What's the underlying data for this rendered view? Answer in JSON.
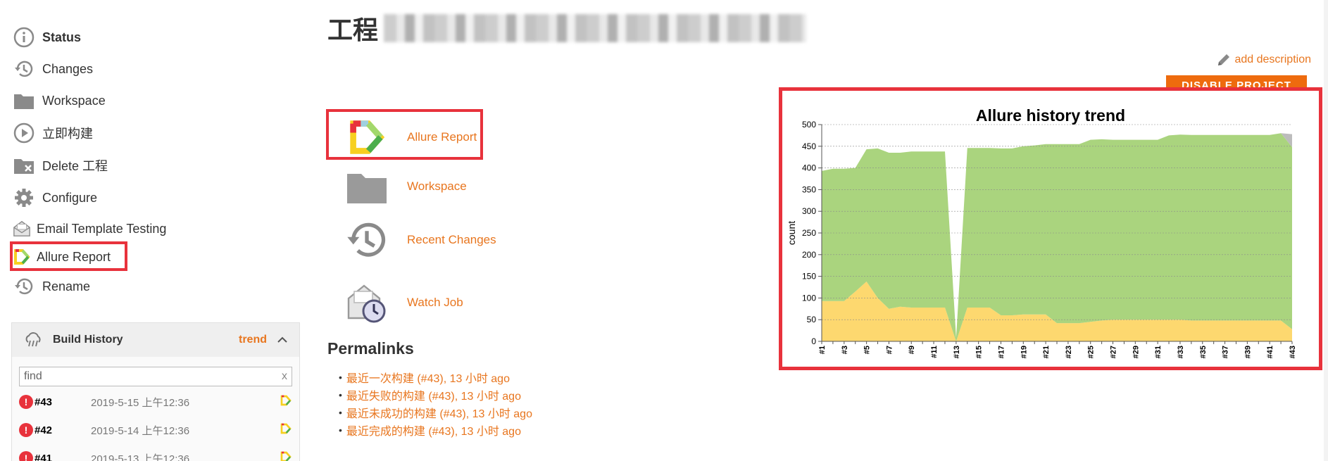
{
  "sidebar": {
    "items": [
      {
        "label": "Status",
        "icon": "info-icon"
      },
      {
        "label": "Changes",
        "icon": "history-icon"
      },
      {
        "label": "Workspace",
        "icon": "folder-icon"
      },
      {
        "label": "立即构建",
        "icon": "play-icon"
      },
      {
        "label": "Delete 工程",
        "icon": "folder-delete-icon"
      },
      {
        "label": "Configure",
        "icon": "gear-icon"
      },
      {
        "label": "Email Template Testing",
        "icon": "envelope-icon"
      },
      {
        "label": "Allure Report",
        "icon": "allure-logo-icon"
      },
      {
        "label": "Rename",
        "icon": "history-icon"
      }
    ]
  },
  "build_history": {
    "title": "Build History",
    "trend_label": "trend",
    "find_placeholder": "find",
    "find_value": "find",
    "clear_label": "x",
    "builds": [
      {
        "number": "#43",
        "date": "2019-5-15 上午12:36"
      },
      {
        "number": "#42",
        "date": "2019-5-14 上午12:36"
      },
      {
        "number": "#41",
        "date": "2019-5-13 上午12:36"
      }
    ]
  },
  "header": {
    "title": "工程"
  },
  "main_links": [
    {
      "label": "Allure Report",
      "icon": "allure-logo-icon"
    },
    {
      "label": "Workspace",
      "icon": "folder-icon"
    },
    {
      "label": "Recent Changes",
      "icon": "history-icon"
    },
    {
      "label": "Watch Job",
      "icon": "envelope-clock-icon"
    }
  ],
  "permalinks": {
    "title": "Permalinks",
    "items": [
      "最近一次构建 (#43), 13 小时 ago",
      "最近失败的构建 (#43), 13 小时 ago",
      "最近未成功的构建 (#43), 13 小时 ago",
      "最近完成的构建 (#43), 13 小时 ago"
    ]
  },
  "actions": {
    "add_description": "add description",
    "disable_project": "DISABLE PROJECT"
  },
  "colors": {
    "accent": "#e8761f",
    "highlight": "#e8323c",
    "button": "#ee6b0e",
    "passed": "#aad47e",
    "failed": "#fdd86f",
    "unknown": "#bcbcbc"
  },
  "chart_data": {
    "type": "area",
    "title": "Allure history trend",
    "ylabel": "count",
    "xlabel": "",
    "ylim": [
      0,
      500
    ],
    "yticks": [
      0,
      50,
      100,
      150,
      200,
      250,
      300,
      350,
      400,
      450,
      500
    ],
    "grid": true,
    "x": [
      "#1",
      "#2",
      "#3",
      "#4",
      "#5",
      "#6",
      "#7",
      "#8",
      "#9",
      "#10",
      "#11",
      "#12",
      "#13",
      "#14",
      "#15",
      "#16",
      "#17",
      "#18",
      "#19",
      "#20",
      "#21",
      "#22",
      "#23",
      "#24",
      "#25",
      "#26",
      "#27",
      "#28",
      "#29",
      "#30",
      "#31",
      "#32",
      "#33",
      "#34",
      "#35",
      "#36",
      "#37",
      "#38",
      "#39",
      "#40",
      "#41",
      "#42",
      "#43"
    ],
    "xtick_labels": [
      "#1",
      "#3",
      "#5",
      "#7",
      "#9",
      "#11",
      "#13",
      "#15",
      "#17",
      "#19",
      "#21",
      "#23",
      "#25",
      "#27",
      "#29",
      "#31",
      "#33",
      "#35",
      "#37",
      "#39",
      "#41",
      "#43"
    ],
    "series": [
      {
        "values": [
          93,
          93,
          93,
          115,
          138,
          100,
          75,
          80,
          78,
          78,
          78,
          78,
          0,
          78,
          78,
          78,
          60,
          60,
          62,
          62,
          62,
          42,
          42,
          42,
          45,
          48,
          50,
          50,
          50,
          50,
          50,
          50,
          50,
          48,
          48,
          48,
          48,
          48,
          48,
          48,
          48,
          48,
          28
        ]
      },
      {
        "values": [
          300,
          305,
          305,
          285,
          305,
          345,
          360,
          355,
          360,
          360,
          360,
          360,
          8,
          368,
          368,
          368,
          385,
          385,
          388,
          390,
          393,
          413,
          413,
          413,
          420,
          418,
          415,
          415,
          415,
          415,
          415,
          425,
          427,
          428,
          428,
          428,
          428,
          428,
          428,
          428,
          428,
          432,
          420
        ]
      },
      {
        "values": [
          0,
          0,
          0,
          0,
          0,
          0,
          0,
          0,
          0,
          0,
          0,
          0,
          0,
          0,
          0,
          0,
          0,
          0,
          0,
          0,
          0,
          0,
          0,
          0,
          0,
          0,
          0,
          0,
          0,
          0,
          0,
          0,
          0,
          0,
          0,
          0,
          0,
          0,
          0,
          0,
          0,
          0,
          30
        ]
      }
    ]
  }
}
